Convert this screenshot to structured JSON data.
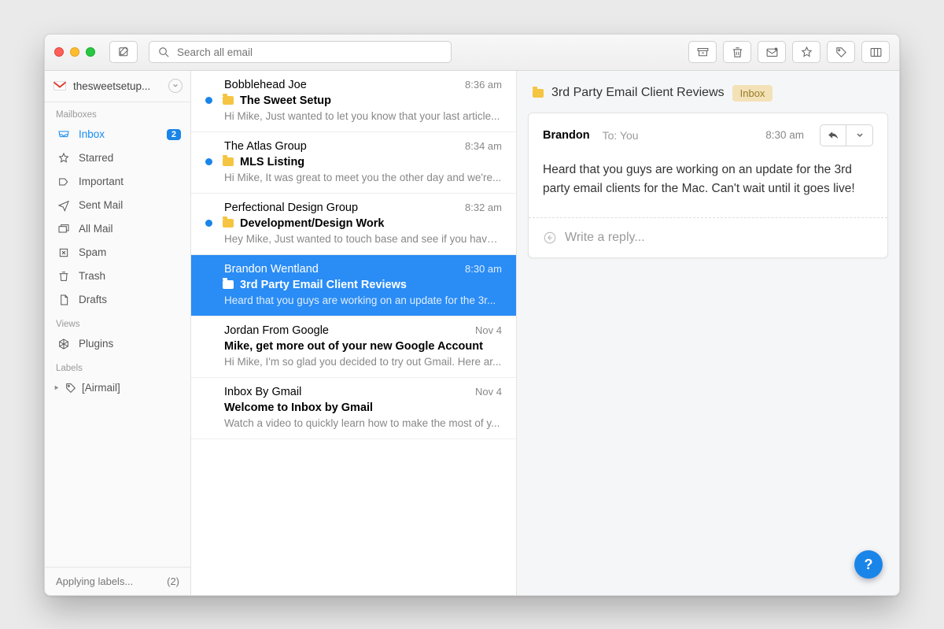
{
  "search_placeholder": "Search all email",
  "account_name": "thesweetsetup...",
  "sections": {
    "mailboxes_title": "Mailboxes",
    "views_title": "Views",
    "labels_title": "Labels"
  },
  "mailboxes": [
    {
      "icon": "inbox",
      "label": "Inbox",
      "badge": "2",
      "active": true
    },
    {
      "icon": "star",
      "label": "Starred"
    },
    {
      "icon": "important",
      "label": "Important"
    },
    {
      "icon": "sent",
      "label": "Sent Mail"
    },
    {
      "icon": "allmail",
      "label": "All Mail"
    },
    {
      "icon": "spam",
      "label": "Spam"
    },
    {
      "icon": "trash",
      "label": "Trash"
    },
    {
      "icon": "drafts",
      "label": "Drafts"
    }
  ],
  "views": [
    {
      "icon": "plugins",
      "label": "Plugins"
    }
  ],
  "labels": [
    {
      "label": "[Airmail]"
    }
  ],
  "status": {
    "text": "Applying labels...",
    "count": "(2)"
  },
  "messages": [
    {
      "sender": "Bobblehead Joe",
      "time": "8:36 am",
      "unread": true,
      "tag": "folder",
      "subject": "The Sweet Setup",
      "preview": "Hi Mike, Just wanted to let you know that your last article..."
    },
    {
      "sender": "The Atlas Group",
      "time": "8:34 am",
      "unread": true,
      "tag": "folder",
      "subject": "MLS Listing",
      "preview": "Hi Mike, It was great to meet you the other day and we're..."
    },
    {
      "sender": "Perfectional Design Group",
      "time": "8:32 am",
      "unread": true,
      "tag": "folder",
      "subject": "Development/Design Work",
      "preview": "Hey Mike, Just wanted to touch base and see if you have ..."
    },
    {
      "sender": "Brandon Wentland",
      "time": "8:30 am",
      "unread": false,
      "selected": true,
      "tag": "folder",
      "subject": "3rd Party Email Client Reviews",
      "preview": "Heard that you guys are working on an update for the 3r..."
    },
    {
      "sender": "Jordan From Google",
      "time": "Nov 4",
      "unread": false,
      "subject": "Mike, get more out of your new Google Account",
      "preview": "Hi Mike, I'm so glad you decided to try out Gmail. Here ar..."
    },
    {
      "sender": "Inbox By Gmail",
      "time": "Nov 4",
      "unread": false,
      "subject": "Welcome to Inbox by Gmail",
      "preview": "Watch a video to quickly learn how to make the most of y..."
    }
  ],
  "reader": {
    "subject": "3rd Party Email Client Reviews",
    "chip": "Inbox",
    "from": "Brandon",
    "to_prefix": "To:",
    "to": "You",
    "time": "8:30 am",
    "body": "Heard that you guys  are working on an update for the 3rd party email clients for the Mac.  Can't wait until it goes live!",
    "reply_placeholder": "Write a reply..."
  },
  "help": "?"
}
